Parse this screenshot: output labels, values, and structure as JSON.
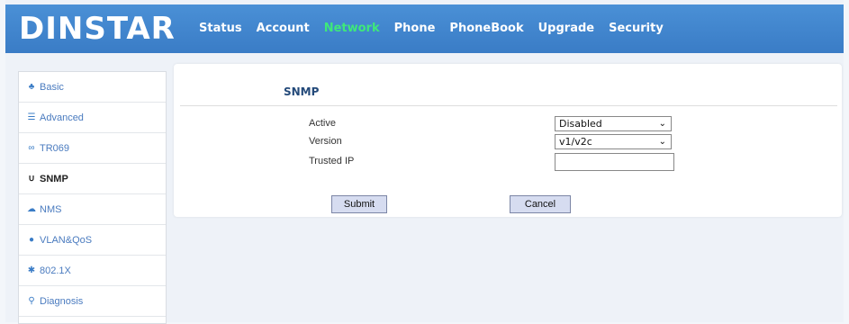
{
  "header": {
    "logo": "DINSTAR",
    "nav": [
      {
        "label": "Status"
      },
      {
        "label": "Account"
      },
      {
        "label": "Network",
        "active": true
      },
      {
        "label": "Phone"
      },
      {
        "label": "PhoneBook"
      },
      {
        "label": "Upgrade"
      },
      {
        "label": "Security"
      }
    ],
    "active_color": "#3ee87a"
  },
  "sidebar": {
    "items": [
      {
        "label": "Basic",
        "icon": "sitemap-icon"
      },
      {
        "label": "Advanced",
        "icon": "list-icon"
      },
      {
        "label": "TR069",
        "icon": "link-icon"
      },
      {
        "label": "SNMP",
        "icon": "magnet-icon",
        "active": true
      },
      {
        "label": "NMS",
        "icon": "cloud-icon"
      },
      {
        "label": "VLAN&QoS",
        "icon": "map-marker-icon"
      },
      {
        "label": "802.1X",
        "icon": "asterisk-icon"
      },
      {
        "label": "Diagnosis",
        "icon": "search-icon"
      }
    ]
  },
  "main": {
    "title": "SNMP",
    "form": {
      "active_label": "Active",
      "active_value": "Disabled",
      "version_label": "Version",
      "version_value": "v1/v2c",
      "trusted_ip_label": "Trusted IP",
      "trusted_ip_value": ""
    },
    "submit_label": "Submit",
    "cancel_label": "Cancel"
  },
  "colors": {
    "header_bg": "#3a7cc6",
    "button_bg": "#d6dcf0",
    "title_color": "#244a7a"
  }
}
